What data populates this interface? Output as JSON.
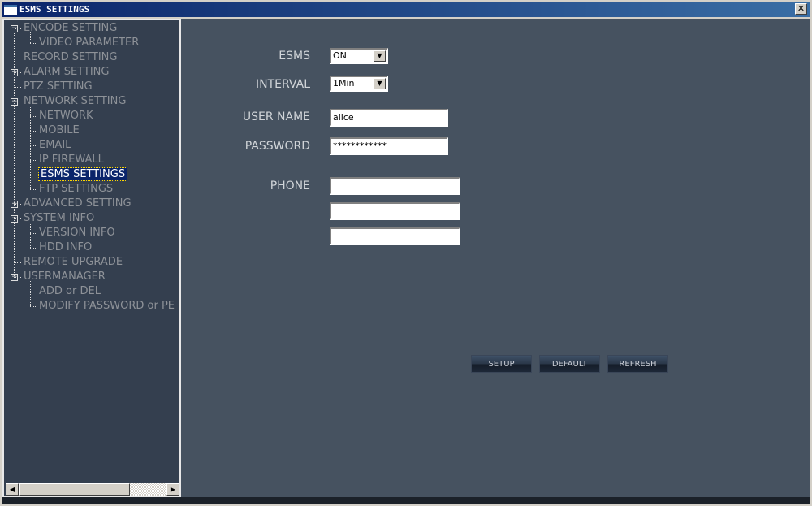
{
  "window": {
    "title": "ESMS SETTINGS",
    "close": "✕"
  },
  "tree": [
    {
      "label": "ENCODE SETTING",
      "level": 0,
      "expander": "−"
    },
    {
      "label": "VIDEO PARAMETER",
      "level": 1
    },
    {
      "label": "RECORD SETTING",
      "level": 0
    },
    {
      "label": "ALARM SETTING",
      "level": 0,
      "expander": "+"
    },
    {
      "label": "PTZ SETTING",
      "level": 0
    },
    {
      "label": "NETWORK SETTING",
      "level": 0,
      "expander": "−"
    },
    {
      "label": "NETWORK",
      "level": 1
    },
    {
      "label": "MOBILE",
      "level": 1
    },
    {
      "label": "EMAIL",
      "level": 1
    },
    {
      "label": "IP FIREWALL",
      "level": 1
    },
    {
      "label": "ESMS SETTINGS",
      "level": 1,
      "selected": true
    },
    {
      "label": "FTP SETTINGS",
      "level": 1
    },
    {
      "label": "ADVANCED SETTING",
      "level": 0,
      "expander": "+"
    },
    {
      "label": "SYSTEM INFO",
      "level": 0,
      "expander": "−"
    },
    {
      "label": "VERSION INFO",
      "level": 1
    },
    {
      "label": "HDD INFO",
      "level": 1
    },
    {
      "label": "REMOTE UPGRADE",
      "level": 0
    },
    {
      "label": "USERMANAGER",
      "level": 0,
      "expander": "−"
    },
    {
      "label": "ADD or DEL",
      "level": 1
    },
    {
      "label": "MODIFY PASSWORD or PE",
      "level": 1
    }
  ],
  "form": {
    "esms_label": "ESMS",
    "esms_value": "ON",
    "interval_label": "INTERVAL",
    "interval_value": "1Min",
    "username_label": "USER NAME",
    "username_value": "alice",
    "password_label": "PASSWORD",
    "password_value": "************",
    "phone_label": "PHONE",
    "phones": [
      "",
      "",
      ""
    ]
  },
  "buttons": {
    "setup": "SETUP",
    "default": "DEFAULT",
    "refresh": "REFRESH"
  }
}
